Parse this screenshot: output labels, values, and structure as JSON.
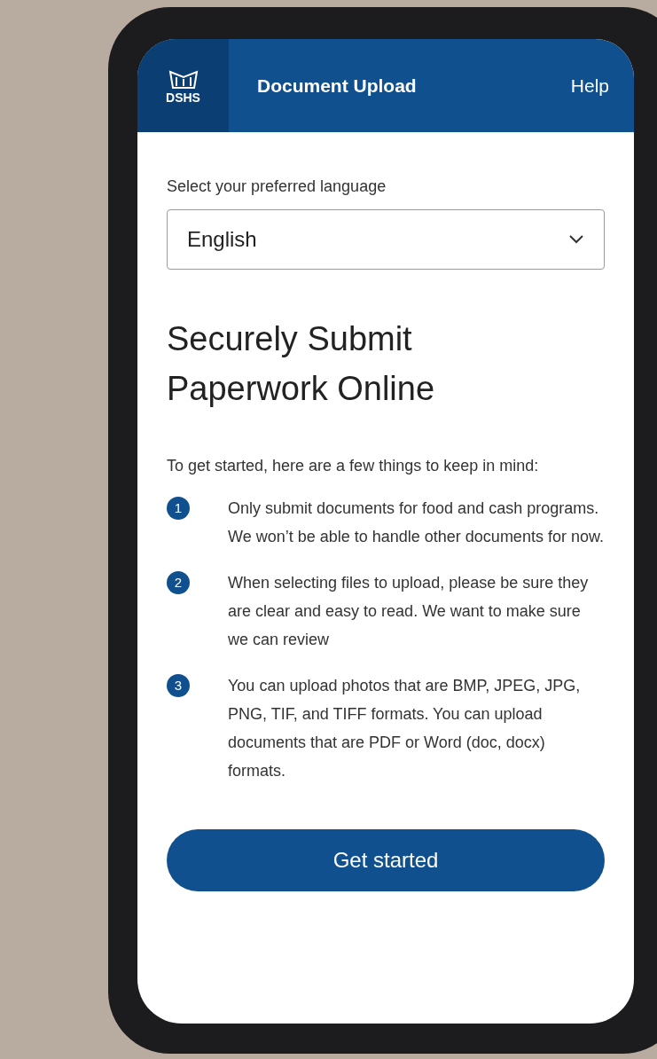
{
  "header": {
    "logo_text": "DSHS",
    "title": "Document Upload",
    "help": "Help"
  },
  "language": {
    "label": "Select your preferred language",
    "value": "English"
  },
  "heading": "Securely Submit Paperwork Online",
  "intro": "To get started, here are a few things to keep in mind:",
  "steps": [
    {
      "number": "1",
      "text": "Only submit documents for food and cash programs. We won’t be able to handle other documents for now."
    },
    {
      "number": "2",
      "text": "When selecting files to upload, please be sure they are clear and easy to read. We want to make sure we can review"
    },
    {
      "number": "3",
      "text": "You can upload photos that are BMP, JPEG, JPG, PNG, TIF, and TIFF formats. You can upload documents that are PDF or Word (doc, docx) formats."
    }
  ],
  "button": "Get started"
}
